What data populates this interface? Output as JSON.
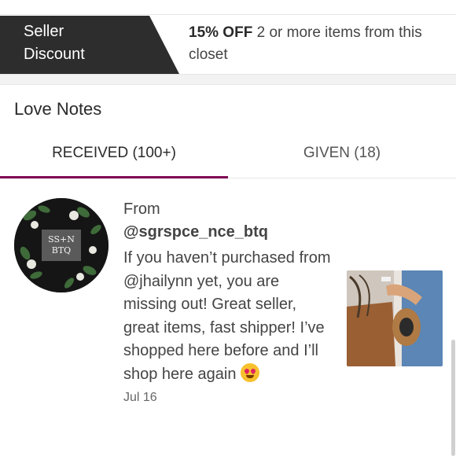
{
  "discount": {
    "tag_line1": "Seller",
    "tag_line2": "Discount",
    "percent": "15% OFF",
    "description": "2 or more items from this closet"
  },
  "love_notes": {
    "title": "Love Notes",
    "tabs": [
      {
        "label": "RECEIVED (100+)",
        "active": true
      },
      {
        "label": "GIVEN (18)",
        "active": false
      }
    ],
    "note": {
      "from_label": "From",
      "username": "@sgrspce_nce_btq",
      "avatar_text_line1": "SS+N",
      "avatar_text_line2": "BTQ",
      "body": "If you haven’t purchased from @jhailynn yet, you are missing out! Great seller, great items, fast shipper! I’ve shopped here before and I’ll shop here again",
      "emoji": "heart-eyes-emoji",
      "date": "Jul 16"
    }
  },
  "colors": {
    "discount_tag_bg": "#2d2d2d",
    "active_tab_underline": "#7f0353"
  }
}
